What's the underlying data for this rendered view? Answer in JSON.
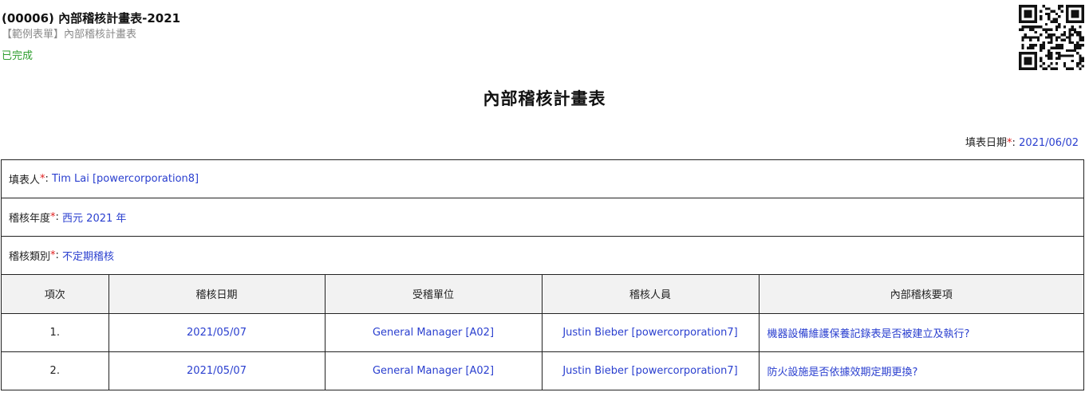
{
  "header": {
    "title": "(00006) 內部稽核計畫表-2021",
    "subtitle": "【範例表單】內部稽核計畫表",
    "status": "已完成",
    "status_color": "#2e9e2e"
  },
  "qr_icon": "qr-code-icon",
  "form": {
    "title": "內部稽核計畫表",
    "fill_date": {
      "label": "填表日期",
      "required": "*",
      "sep": ":",
      "value": "2021/06/02"
    },
    "filler": {
      "label": "填表人",
      "required": "*",
      "sep": ":",
      "value": "Tim Lai [powercorporation8]"
    },
    "audit_year": {
      "label": "稽核年度",
      "required": "*",
      "sep": ":",
      "value": "西元 2021 年"
    },
    "audit_type": {
      "label": "稽核類別",
      "required": "*",
      "sep": ":",
      "value": "不定期稽核"
    }
  },
  "table": {
    "headers": [
      "項次",
      "稽核日期",
      "受稽單位",
      "稽核人員",
      "內部稽核要項"
    ],
    "rows": [
      [
        "1.",
        "2021/05/07",
        "General Manager [A02]",
        "Justin Bieber [powercorporation7]",
        "機器設備維護保養記錄表是否被建立及執行?"
      ],
      [
        "2.",
        "2021/05/07",
        "General Manager [A02]",
        "Justin Bieber [powercorporation7]",
        "防火設施是否依據效期定期更換?"
      ]
    ]
  },
  "colors": {
    "value": "#2a3fcf",
    "required": "#e02020",
    "header_bg": "#f2f2f2"
  }
}
